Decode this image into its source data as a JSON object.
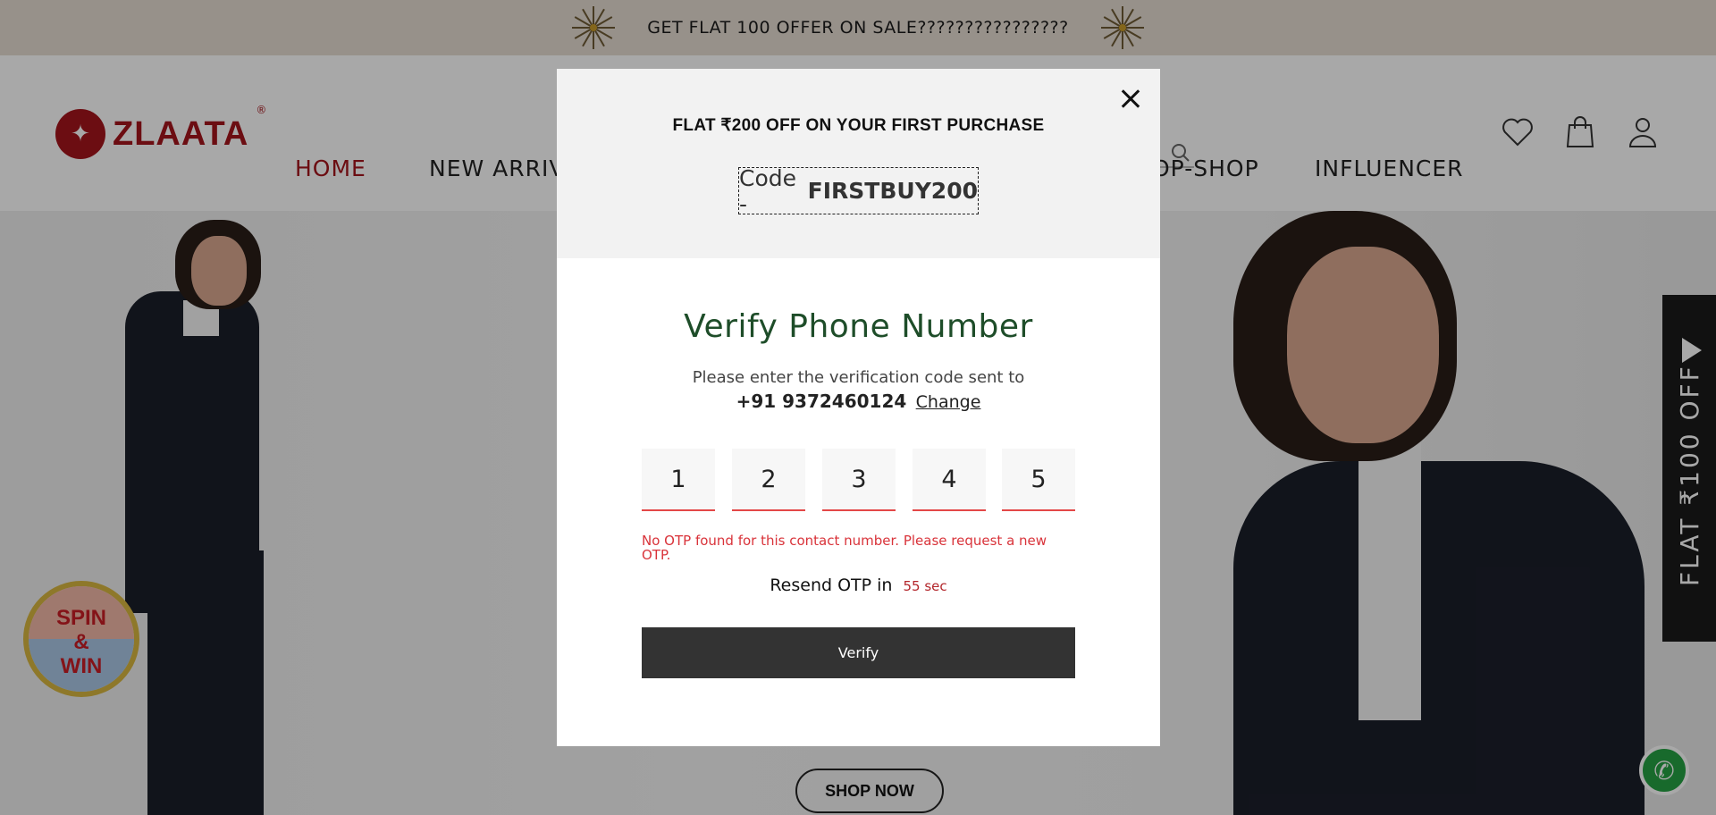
{
  "announcement": {
    "text": "GET FLAT 100 OFFER ON SALE????????????????"
  },
  "brand": {
    "name": "ZLAATA",
    "reg_mark": "®"
  },
  "nav": {
    "items": [
      {
        "label": "HOME"
      },
      {
        "label": "NEW ARRIV"
      },
      {
        "label": "OP-SHOP"
      },
      {
        "label": "INFLUENCER"
      }
    ]
  },
  "hero": {
    "cta_label": "SHOP NOW"
  },
  "spin_widget": {
    "line1": "SPIN",
    "line2": "&",
    "line3": "WIN"
  },
  "side_tab": {
    "label": "FLAT ₹100 OFF"
  },
  "modal": {
    "offer_title": "FLAT ₹200 OFF ON YOUR FIRST PURCHASE",
    "code_label": "Code -",
    "code_value": "FIRSTBUY200",
    "title": "Verify Phone Number",
    "subtitle": "Please enter the verification code sent to",
    "phone": "+91 9372460124",
    "change_label": "Change",
    "otp_digits": [
      "1",
      "2",
      "3",
      "4",
      "5"
    ],
    "error": "No OTP found for this contact number. Please request a new OTP.",
    "resend_label": "Resend OTP in",
    "resend_timer": "55 sec",
    "verify_label": "Verify"
  },
  "colors": {
    "brand_red": "#a4151c",
    "verify_title": "#1e4d29",
    "error_red": "#d9333a",
    "button_dark": "#333333",
    "announcement_bg": "#e6ddd2"
  }
}
